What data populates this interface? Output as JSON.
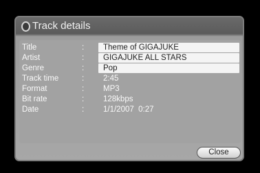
{
  "dialog": {
    "title": "Track details",
    "close_label": "Close"
  },
  "fields": [
    {
      "label": "Title",
      "separator": ":",
      "value": "Theme of GIGAJUKE"
    },
    {
      "label": "Artist",
      "separator": ":",
      "value": "GIGAJUKE ALL STARS"
    },
    {
      "label": "Genre",
      "separator": ":",
      "value": "Pop"
    },
    {
      "label": "Track time",
      "separator": ":",
      "value": "2:45"
    },
    {
      "label": "Format",
      "separator": ":",
      "value": "MP3"
    },
    {
      "label": "Bit rate",
      "separator": ":",
      "value": "128kbps"
    },
    {
      "label": "Date",
      "separator": ":",
      "value": "1/1/2007  0:27"
    }
  ],
  "icons": {
    "title_icon": "circle-outline-icon"
  }
}
